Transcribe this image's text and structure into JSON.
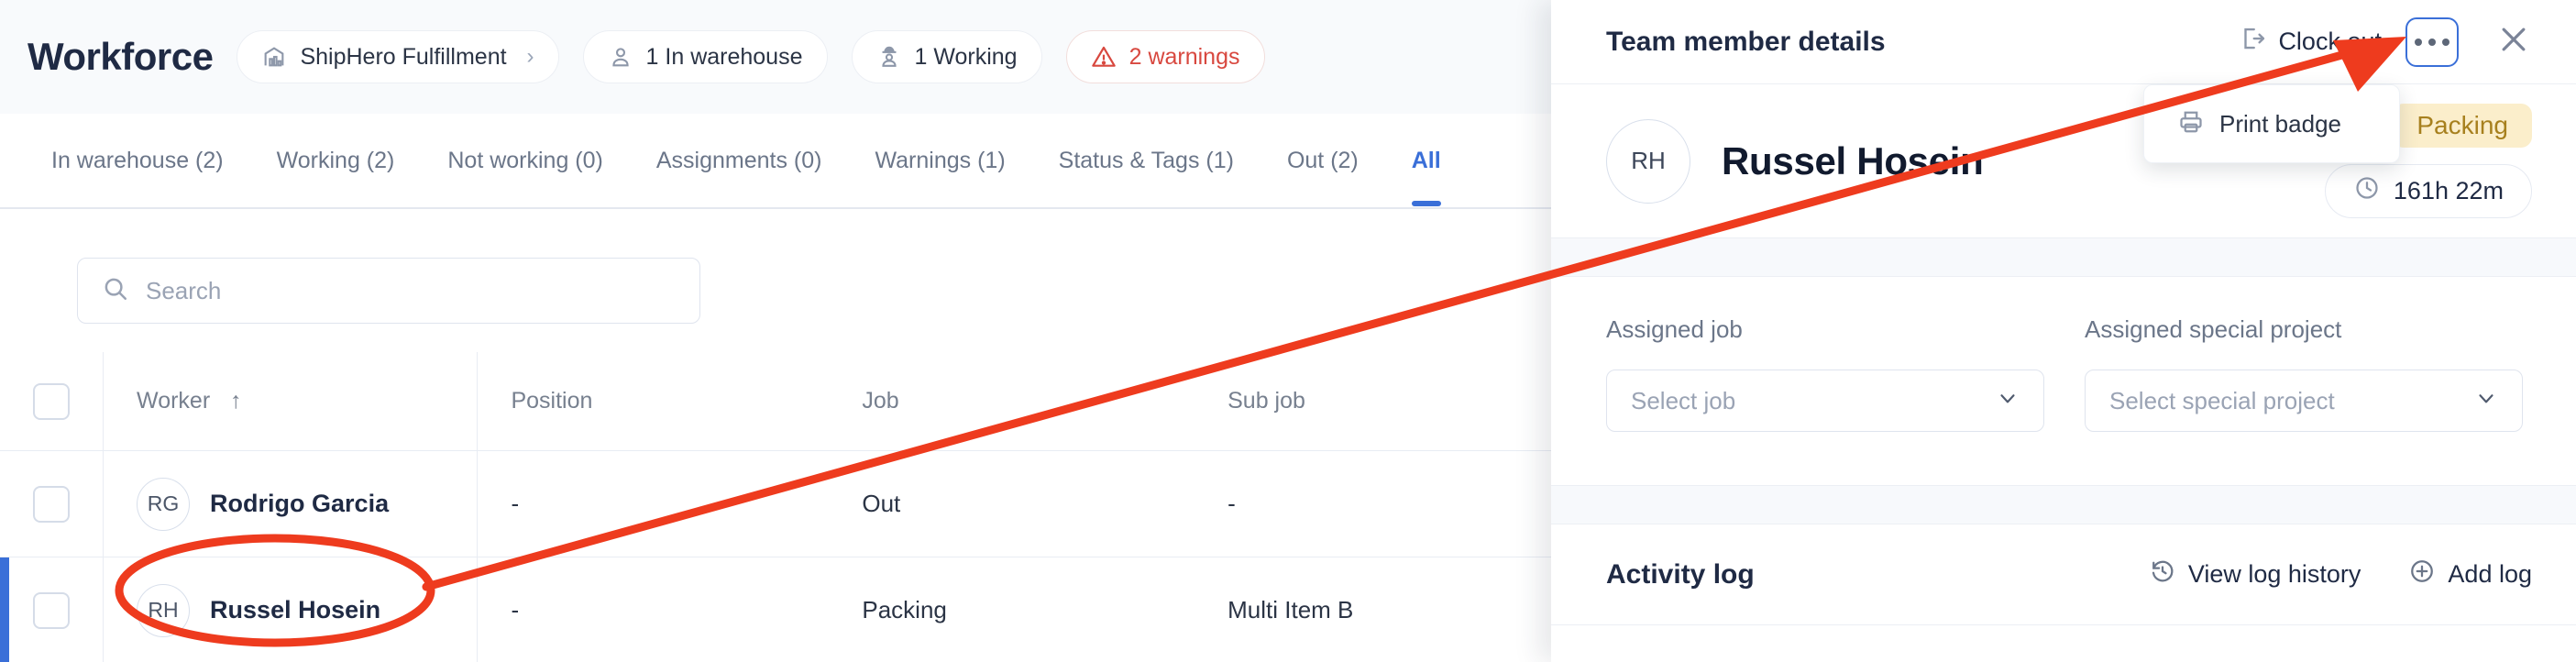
{
  "header": {
    "title": "Workforce",
    "chips": [
      {
        "icon": "warehouse-icon",
        "label": "ShipHero Fulfillment",
        "chevron": "›",
        "type": "org"
      },
      {
        "icon": "person-icon",
        "label": "1 In warehouse",
        "type": "count"
      },
      {
        "icon": "worker-helmet-icon",
        "label": "1 Working",
        "type": "count"
      },
      {
        "icon": "warning-triangle-icon",
        "label": "2 warnings",
        "type": "warning"
      }
    ]
  },
  "tabs": [
    {
      "label": "In warehouse (2)",
      "active": false
    },
    {
      "label": "Working (2)",
      "active": false
    },
    {
      "label": "Not working (0)",
      "active": false
    },
    {
      "label": "Assignments (0)",
      "active": false
    },
    {
      "label": "Warnings (1)",
      "active": false
    },
    {
      "label": "Status & Tags (1)",
      "active": false
    },
    {
      "label": "Out (2)",
      "active": false
    },
    {
      "label": "All",
      "active": true
    }
  ],
  "search": {
    "placeholder": "Search",
    "value": ""
  },
  "table": {
    "columns": [
      "Worker",
      "Position",
      "Job",
      "Sub job"
    ],
    "sort_column": "Worker",
    "sort_direction": "↑",
    "rows": [
      {
        "initials": "RG",
        "worker": "Rodrigo Garcia",
        "position": "-",
        "job": "Out",
        "sub_job": "-",
        "selected": false,
        "checked": false
      },
      {
        "initials": "RH",
        "worker": "Russel Hosein",
        "position": "-",
        "job": "Packing",
        "sub_job": "Multi Item B",
        "selected": true,
        "checked": false
      }
    ]
  },
  "panel": {
    "title": "Team member details",
    "clock_out_label": "Clock out",
    "more_menu_icon": "ellipsis-icon",
    "close_icon": "close-icon",
    "menu": {
      "open": true,
      "items": [
        {
          "icon": "printer-icon",
          "label": "Print badge"
        }
      ]
    },
    "profile": {
      "initials": "RH",
      "name": "Russel Hosein",
      "status": "Packing",
      "time_worked": "161h 22m"
    },
    "assigned": {
      "job_label": "Assigned job",
      "job_placeholder": "Select job",
      "job_value": "",
      "project_label": "Assigned special project",
      "project_placeholder": "Select special project",
      "project_value": ""
    },
    "activity": {
      "title": "Activity log",
      "view_history_label": "View log history",
      "add_log_label": "Add log"
    }
  },
  "annotation": {
    "color": "#EE3B1E",
    "type": "arrow-and-ellipse",
    "ellipse_target": "Russel Hosein",
    "arrow_target": "more-menu-button"
  },
  "colors": {
    "accent_blue": "#3a6fd8",
    "warning_red": "#d8483f",
    "status_amber_bg": "#fbeecb",
    "status_amber_text": "#a7801e",
    "header_bg": "#f8fafc",
    "text_primary": "#1f2a44",
    "text_muted": "#6b7689"
  }
}
